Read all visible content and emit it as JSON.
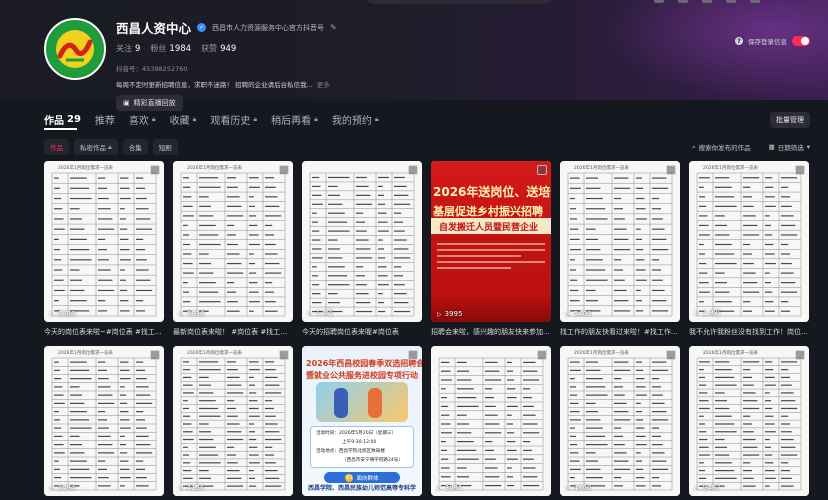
{
  "profile": {
    "name": "西昌人资中心",
    "verify_text": "西昌市人力资源服务中心官方抖音号",
    "follow_label": "关注",
    "follow_count": "9",
    "fans_label": "粉丝",
    "fans_count": "1984",
    "likes_label": "获赞",
    "likes_count": "949",
    "douyin_id": "抖音号：45398252760",
    "bio": "每周不定时更新招聘信息，求职不迷路！ 招聘的企业请后台私信我...",
    "bio_more": "更多",
    "replay_label": "精彩直播回放",
    "save_login_label": "保存登录信息"
  },
  "tabs": [
    {
      "label": "作品",
      "count": "29",
      "locked": false
    },
    {
      "label": "推荐",
      "locked": false
    },
    {
      "label": "喜欢",
      "locked": true
    },
    {
      "label": "收藏",
      "locked": true
    },
    {
      "label": "观看历史",
      "locked": true
    },
    {
      "label": "稍后再看",
      "locked": true
    },
    {
      "label": "我的预约",
      "locked": true
    }
  ],
  "batch_manage_label": "批量管理",
  "filters": [
    "作品",
    "私密作品",
    "合集",
    "短剧"
  ],
  "search_works_label": "搜索你发布的作品",
  "date_filter_label": "日期筛选",
  "videos": [
    {
      "caption": "今天的岗位表来啦~#岗位表 #找工...",
      "plays": "8988",
      "kind": "doc",
      "doc_title": "2026年1月岗位需求一览表"
    },
    {
      "caption": "最新岗位表来啦！ #岗位表 #找工作...",
      "plays": "7836",
      "kind": "doc",
      "doc_title": "2026年1月岗位需求一览表"
    },
    {
      "caption": "今天的招聘岗位表来喔#岗位表",
      "plays": "1.4万",
      "kind": "doc",
      "doc_title": ""
    },
    {
      "caption": "招聘会来啦，感兴趣的朋友快来参加...",
      "plays": "3995",
      "kind": "poster-red",
      "poster_line1": "2026年送岗位、送培训、",
      "poster_line2": "基层促进乡村振兴招聘",
      "poster_line3": "自发搬迁人员暨民营企业"
    },
    {
      "caption": "找工作的朋友快看过来啦！#找工作...",
      "plays": "5409",
      "kind": "doc",
      "doc_title": "2026年1月岗位需求一览表"
    },
    {
      "caption": "我不允许我粉丝没有找到工作！岗位...",
      "plays": "1.8万",
      "kind": "doc",
      "doc_title": "2026年1月岗位需求一览表"
    },
    {
      "caption": "",
      "plays": "2484",
      "kind": "doc",
      "doc_title": "2026年1月岗位需求一览表"
    },
    {
      "caption": "",
      "plays": "4156",
      "kind": "doc",
      "doc_title": "2026年1月岗位需求一览表"
    },
    {
      "caption": "",
      "plays": "",
      "kind": "poster-blue",
      "poster_title1": "2026年西昌校园春季双选招聘会",
      "poster_title2": "暨就业公共服务进校园专项行动",
      "info1": "活动时间：2026年5月20日（星期三）",
      "info2": "上午9:30-12:00",
      "info3": "活动地点：西昌学院北校区致知楼",
      "info4": "（西昌市安宁镇学府路24号）",
      "badge_num": "01",
      "badge_label": "面向群体",
      "bottom_text": "西昌学院、西昌民族幼儿师范高等专科学"
    },
    {
      "caption": "",
      "plays": "3061",
      "kind": "doc",
      "doc_title": ""
    },
    {
      "caption": "",
      "plays": "4800",
      "kind": "doc",
      "doc_title": "2026年1月岗位需求一览表"
    },
    {
      "caption": "",
      "plays": "9487",
      "kind": "doc",
      "doc_title": "2026年1月岗位需求一览表"
    }
  ],
  "colors": {
    "accent": "#fe2c55",
    "background": "#16181f"
  },
  "icons": [
    "verified-icon",
    "edit-icon",
    "live-replay-icon",
    "help-icon",
    "lock-icon",
    "search-icon",
    "calendar-icon",
    "play-icon"
  ]
}
